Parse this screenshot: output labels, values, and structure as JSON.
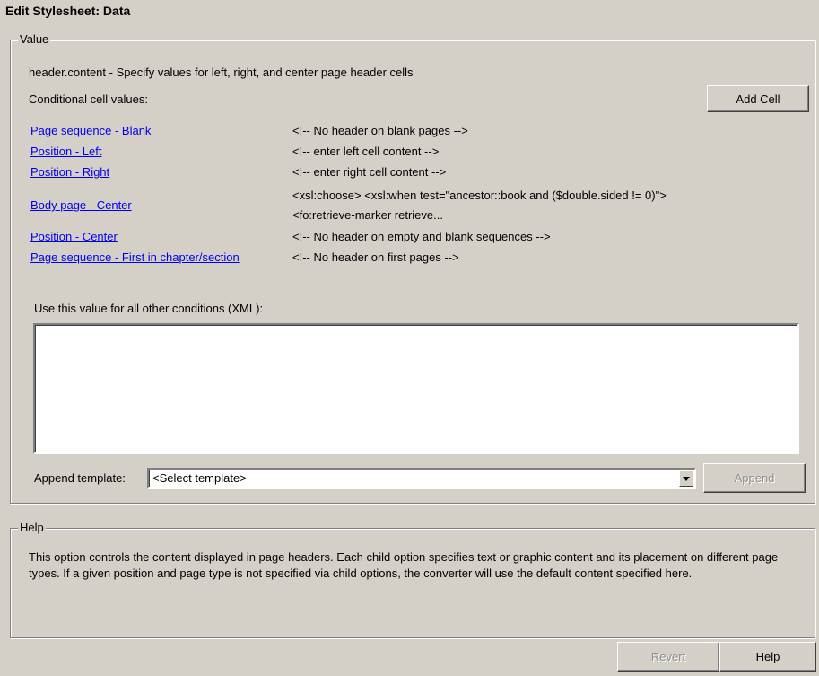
{
  "window": {
    "title": "Edit Stylesheet: Data"
  },
  "value_group": {
    "legend": "Value",
    "description": "header.content - Specify values for left, right, and center page header cells",
    "conditional_label": "Conditional cell values:",
    "add_cell_label": "Add Cell",
    "cells": [
      {
        "condition": "Page sequence - Blank",
        "value": "<!-- No header on blank pages -->"
      },
      {
        "condition": "Position - Left",
        "value": "<!-- enter left cell content -->"
      },
      {
        "condition": "Position - Right",
        "value": "<!-- enter right cell content -->"
      },
      {
        "condition": "Body page - Center",
        "value": "<xsl:choose>            <xsl:when test=\"ancestor::book and ($double.sided != 0)\">",
        "value_line2": "<fo:retrieve-marker retrieve..."
      },
      {
        "condition": "Position - Center",
        "value": "<!-- No header on empty and blank sequences -->"
      },
      {
        "condition": "Page sequence - First in chapter/section",
        "value": "<!-- No header on first pages -->"
      }
    ],
    "default_label": "Use this value for all other conditions (XML):",
    "default_value": "",
    "append_template_label": "Append template:",
    "template_select_value": "<Select template>",
    "append_label": "Append"
  },
  "help_group": {
    "legend": "Help",
    "text": "This option controls the content displayed in page headers.  Each child option specifies text or graphic content and its placement on different page types.  If a given position and page type is not specified via child options, the converter will use the default content specified here."
  },
  "footer": {
    "revert_label": "Revert",
    "help_label": "Help"
  },
  "icons": {
    "dropdown": "chevron-down-icon"
  }
}
